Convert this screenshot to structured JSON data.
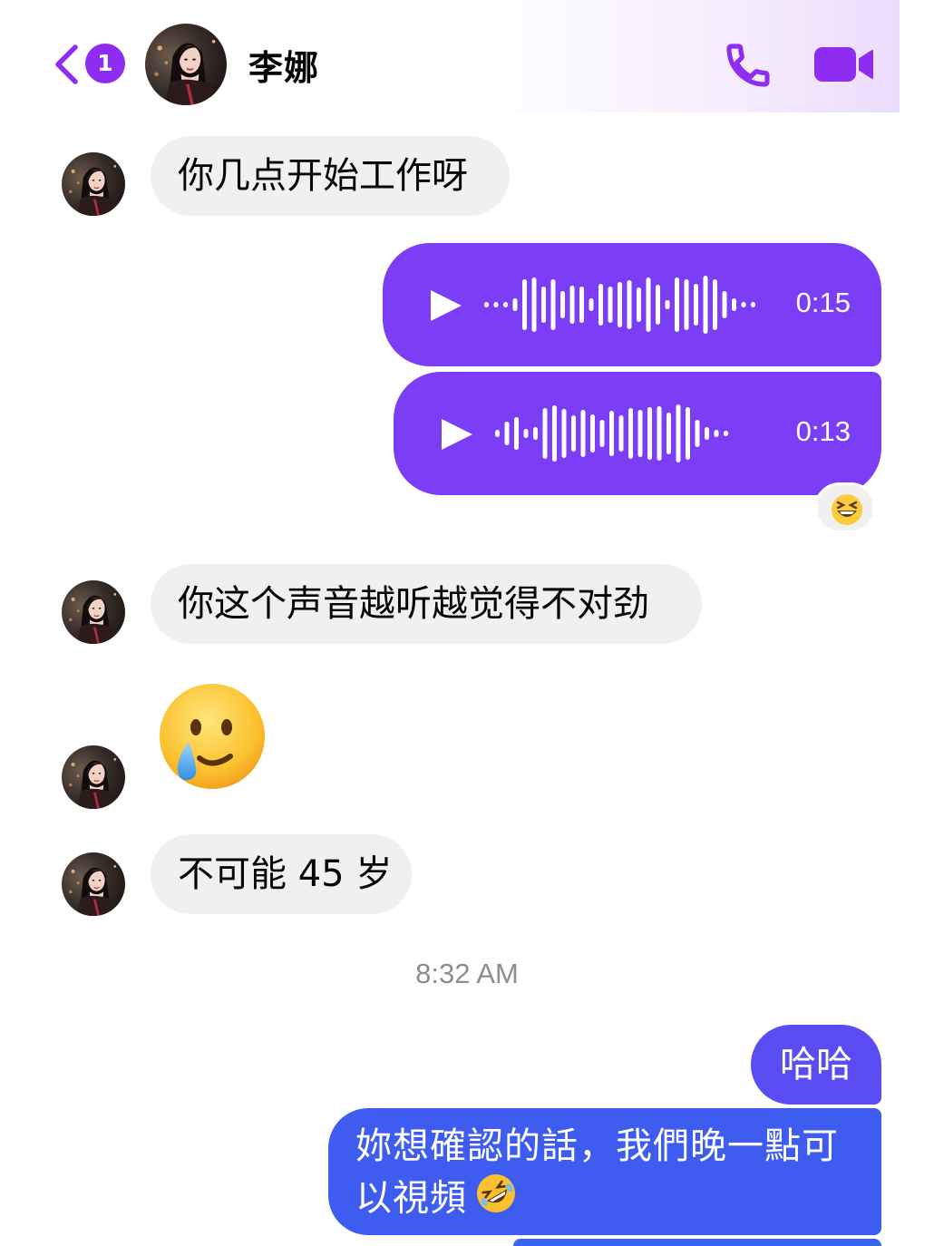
{
  "header": {
    "unread_count": "1",
    "contact_name": "李娜",
    "icons": {
      "back": "chevron-left-icon",
      "call": "phone-icon",
      "video": "video-camera-icon"
    },
    "accent_color": "#8e2cf1"
  },
  "messages": {
    "incoming_1": "你几点开始工作呀",
    "voice_1_duration": "0:15",
    "voice_2_duration": "0:13",
    "reaction_emoji": "grinning-squinting-face",
    "incoming_2": "你这个声音越听越觉得不对劲",
    "incoming_emoji": "smiling-face-with-tear",
    "incoming_3": "不可能 45 岁",
    "timestamp": "8:32 AM",
    "outgoing_1": "哈哈",
    "outgoing_2": "妳想確認的話，我們晚一點可以視頻",
    "outgoing_2_emoji": "rolling-on-the-floor-laughing"
  },
  "colors": {
    "voice_bubble": "#7b3df6",
    "outgoing_top": "#5a4cf3",
    "outgoing_bottom": "#3f5cf0",
    "incoming_bubble": "#f0f0f0",
    "timestamp": "#8a8d91"
  }
}
